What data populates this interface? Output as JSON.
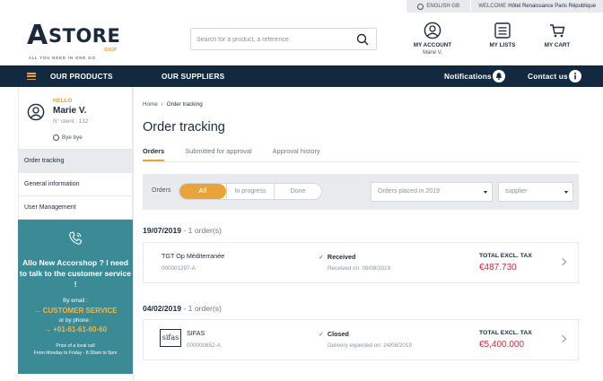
{
  "topbar": {
    "language": "ENGLISH GB",
    "welcome_prefix": "WELCOME",
    "venue": "Hôtel Renaissance Paris République"
  },
  "brand": {
    "logo_initial": "A",
    "logo_word": "STORE",
    "logo_shop": "SHOP",
    "tagline": "ALL YOU NEED IN ONE GO",
    "accent_color": "#e8a33b",
    "navy_color": "#12293f",
    "teal_color": "#3a8b96",
    "price_color": "#d6283c"
  },
  "search": {
    "placeholder": "Search for a product, a reference"
  },
  "header": {
    "account_label": "MY ACCOUNT",
    "account_user": "Marie V.",
    "lists_label": "MY LISTS",
    "cart_label": "MY CART"
  },
  "nav": {
    "products": "OUR PRODUCTS",
    "suppliers": "OUR SUPPLIERS",
    "notifications": "Notifications",
    "contact": "Contact us"
  },
  "user": {
    "hello": "HELLO",
    "name": "Marie V.",
    "client": "N° client : 132",
    "logout": "Bye bye"
  },
  "sidemenu": {
    "items": [
      "Order tracking",
      "General information",
      "User Management"
    ]
  },
  "support": {
    "headline": "Allo New Accorshop ? I need to talk to the customer service !",
    "by_email": "By email :",
    "email_link": "CUSTOMER SERVICE",
    "by_phone": "or by phone :",
    "phone": "+01-61-61-60-60",
    "price_note": "Price of a local call",
    "hours": "From Monday to Friday - 8:30am to 5pm"
  },
  "main": {
    "breadcrumb_home": "Home",
    "breadcrumb_current": "Order tracking",
    "title": "Order tracking",
    "tabs": [
      "Orders",
      "Submitted for approval",
      "Approval history"
    ]
  },
  "filters": {
    "label": "Orders",
    "segments": [
      "All",
      "In progress",
      "Done"
    ],
    "period": "Orders placed in 2019",
    "supplier": "supplier"
  },
  "groups": [
    {
      "date": "19/07/2019",
      "count": "- 1 order(s)",
      "order": {
        "supplier": "TGT Op Méditerranée",
        "number": "000001297-A",
        "status": "Received",
        "status_date": "Received on: 09/08/2019",
        "total_label": "TOTAL EXCL. TAX",
        "amount": "€487.730"
      }
    },
    {
      "date": "04/02/2019",
      "count": "- 1 order(s)",
      "order": {
        "logo_text": "sifas",
        "supplier": "SIFAS",
        "number": "000000852-A",
        "status": "Closed",
        "status_date": "Delivery expected on: 24/08/2019",
        "total_label": "TOTAL EXCL. TAX",
        "amount": "€5,400.000"
      }
    }
  ]
}
